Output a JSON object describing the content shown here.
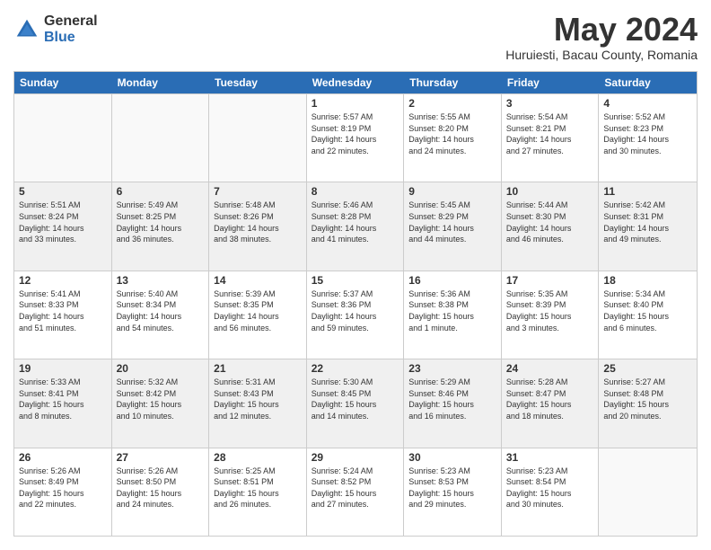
{
  "logo": {
    "general": "General",
    "blue": "Blue"
  },
  "title": "May 2024",
  "location": "Huruiesti, Bacau County, Romania",
  "weekdays": [
    "Sunday",
    "Monday",
    "Tuesday",
    "Wednesday",
    "Thursday",
    "Friday",
    "Saturday"
  ],
  "weeks": [
    [
      {
        "day": "",
        "lines": []
      },
      {
        "day": "",
        "lines": []
      },
      {
        "day": "",
        "lines": []
      },
      {
        "day": "1",
        "lines": [
          "Sunrise: 5:57 AM",
          "Sunset: 8:19 PM",
          "Daylight: 14 hours",
          "and 22 minutes."
        ]
      },
      {
        "day": "2",
        "lines": [
          "Sunrise: 5:55 AM",
          "Sunset: 8:20 PM",
          "Daylight: 14 hours",
          "and 24 minutes."
        ]
      },
      {
        "day": "3",
        "lines": [
          "Sunrise: 5:54 AM",
          "Sunset: 8:21 PM",
          "Daylight: 14 hours",
          "and 27 minutes."
        ]
      },
      {
        "day": "4",
        "lines": [
          "Sunrise: 5:52 AM",
          "Sunset: 8:23 PM",
          "Daylight: 14 hours",
          "and 30 minutes."
        ]
      }
    ],
    [
      {
        "day": "5",
        "lines": [
          "Sunrise: 5:51 AM",
          "Sunset: 8:24 PM",
          "Daylight: 14 hours",
          "and 33 minutes."
        ]
      },
      {
        "day": "6",
        "lines": [
          "Sunrise: 5:49 AM",
          "Sunset: 8:25 PM",
          "Daylight: 14 hours",
          "and 36 minutes."
        ]
      },
      {
        "day": "7",
        "lines": [
          "Sunrise: 5:48 AM",
          "Sunset: 8:26 PM",
          "Daylight: 14 hours",
          "and 38 minutes."
        ]
      },
      {
        "day": "8",
        "lines": [
          "Sunrise: 5:46 AM",
          "Sunset: 8:28 PM",
          "Daylight: 14 hours",
          "and 41 minutes."
        ]
      },
      {
        "day": "9",
        "lines": [
          "Sunrise: 5:45 AM",
          "Sunset: 8:29 PM",
          "Daylight: 14 hours",
          "and 44 minutes."
        ]
      },
      {
        "day": "10",
        "lines": [
          "Sunrise: 5:44 AM",
          "Sunset: 8:30 PM",
          "Daylight: 14 hours",
          "and 46 minutes."
        ]
      },
      {
        "day": "11",
        "lines": [
          "Sunrise: 5:42 AM",
          "Sunset: 8:31 PM",
          "Daylight: 14 hours",
          "and 49 minutes."
        ]
      }
    ],
    [
      {
        "day": "12",
        "lines": [
          "Sunrise: 5:41 AM",
          "Sunset: 8:33 PM",
          "Daylight: 14 hours",
          "and 51 minutes."
        ]
      },
      {
        "day": "13",
        "lines": [
          "Sunrise: 5:40 AM",
          "Sunset: 8:34 PM",
          "Daylight: 14 hours",
          "and 54 minutes."
        ]
      },
      {
        "day": "14",
        "lines": [
          "Sunrise: 5:39 AM",
          "Sunset: 8:35 PM",
          "Daylight: 14 hours",
          "and 56 minutes."
        ]
      },
      {
        "day": "15",
        "lines": [
          "Sunrise: 5:37 AM",
          "Sunset: 8:36 PM",
          "Daylight: 14 hours",
          "and 59 minutes."
        ]
      },
      {
        "day": "16",
        "lines": [
          "Sunrise: 5:36 AM",
          "Sunset: 8:38 PM",
          "Daylight: 15 hours",
          "and 1 minute."
        ]
      },
      {
        "day": "17",
        "lines": [
          "Sunrise: 5:35 AM",
          "Sunset: 8:39 PM",
          "Daylight: 15 hours",
          "and 3 minutes."
        ]
      },
      {
        "day": "18",
        "lines": [
          "Sunrise: 5:34 AM",
          "Sunset: 8:40 PM",
          "Daylight: 15 hours",
          "and 6 minutes."
        ]
      }
    ],
    [
      {
        "day": "19",
        "lines": [
          "Sunrise: 5:33 AM",
          "Sunset: 8:41 PM",
          "Daylight: 15 hours",
          "and 8 minutes."
        ]
      },
      {
        "day": "20",
        "lines": [
          "Sunrise: 5:32 AM",
          "Sunset: 8:42 PM",
          "Daylight: 15 hours",
          "and 10 minutes."
        ]
      },
      {
        "day": "21",
        "lines": [
          "Sunrise: 5:31 AM",
          "Sunset: 8:43 PM",
          "Daylight: 15 hours",
          "and 12 minutes."
        ]
      },
      {
        "day": "22",
        "lines": [
          "Sunrise: 5:30 AM",
          "Sunset: 8:45 PM",
          "Daylight: 15 hours",
          "and 14 minutes."
        ]
      },
      {
        "day": "23",
        "lines": [
          "Sunrise: 5:29 AM",
          "Sunset: 8:46 PM",
          "Daylight: 15 hours",
          "and 16 minutes."
        ]
      },
      {
        "day": "24",
        "lines": [
          "Sunrise: 5:28 AM",
          "Sunset: 8:47 PM",
          "Daylight: 15 hours",
          "and 18 minutes."
        ]
      },
      {
        "day": "25",
        "lines": [
          "Sunrise: 5:27 AM",
          "Sunset: 8:48 PM",
          "Daylight: 15 hours",
          "and 20 minutes."
        ]
      }
    ],
    [
      {
        "day": "26",
        "lines": [
          "Sunrise: 5:26 AM",
          "Sunset: 8:49 PM",
          "Daylight: 15 hours",
          "and 22 minutes."
        ]
      },
      {
        "day": "27",
        "lines": [
          "Sunrise: 5:26 AM",
          "Sunset: 8:50 PM",
          "Daylight: 15 hours",
          "and 24 minutes."
        ]
      },
      {
        "day": "28",
        "lines": [
          "Sunrise: 5:25 AM",
          "Sunset: 8:51 PM",
          "Daylight: 15 hours",
          "and 26 minutes."
        ]
      },
      {
        "day": "29",
        "lines": [
          "Sunrise: 5:24 AM",
          "Sunset: 8:52 PM",
          "Daylight: 15 hours",
          "and 27 minutes."
        ]
      },
      {
        "day": "30",
        "lines": [
          "Sunrise: 5:23 AM",
          "Sunset: 8:53 PM",
          "Daylight: 15 hours",
          "and 29 minutes."
        ]
      },
      {
        "day": "31",
        "lines": [
          "Sunrise: 5:23 AM",
          "Sunset: 8:54 PM",
          "Daylight: 15 hours",
          "and 30 minutes."
        ]
      },
      {
        "day": "",
        "lines": []
      }
    ]
  ]
}
